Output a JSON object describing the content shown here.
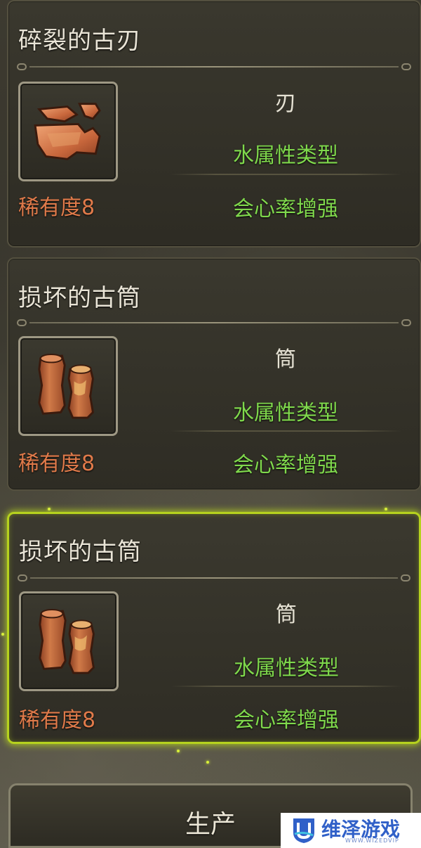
{
  "cards": [
    {
      "title": "碎裂的古刃",
      "rarity": "稀有度8",
      "weapon_type": "刃",
      "element": "水属性类型",
      "bonus": "会心率增强",
      "icon": "broken-blade-icon",
      "selected": false
    },
    {
      "title": "损坏的古筒",
      "rarity": "稀有度8",
      "weapon_type": "筒",
      "element": "水属性类型",
      "bonus": "会心率增强",
      "icon": "broken-tube-icon",
      "selected": false
    },
    {
      "title": "损坏的古筒",
      "rarity": "稀有度8",
      "weapon_type": "筒",
      "element": "水属性类型",
      "bonus": "会心率增强",
      "icon": "broken-tube-icon",
      "selected": true
    }
  ],
  "produce_button": {
    "label": "生产"
  },
  "watermark": {
    "text": "维泽游戏",
    "sub": "WWW.WIZEDVIP"
  },
  "colors": {
    "rarity": "#e07a4a",
    "stat_green": "#7fd84c",
    "selected_border": "#b6d21e",
    "watermark_blue": "#3060c8"
  }
}
